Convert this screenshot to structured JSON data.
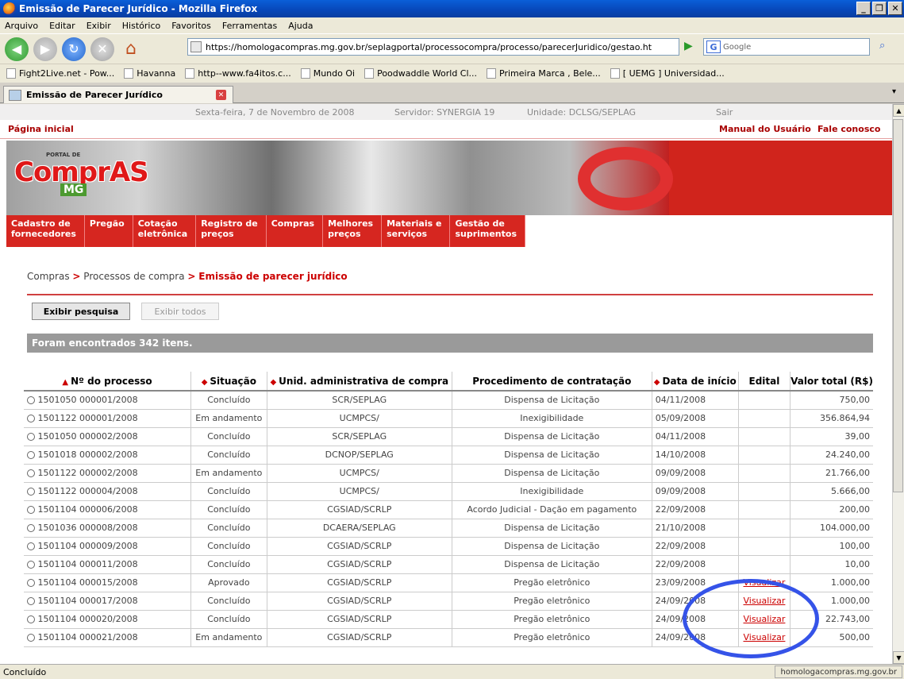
{
  "window": {
    "title": "Emissão de Parecer Jurídico - Mozilla Firefox"
  },
  "menubar": [
    "Arquivo",
    "Editar",
    "Exibir",
    "Histórico",
    "Favoritos",
    "Ferramentas",
    "Ajuda"
  ],
  "nav": {
    "url": "https://homologacompras.mg.gov.br/seplagportal/processocompra/processo/parecerJuridico/gestao.ht",
    "search_placeholder": "Google"
  },
  "bookmarks": [
    "Fight2Live.net - Pow...",
    "Havanna",
    "http--www.fa4itos.c...",
    "Mundo Oi",
    "Poodwaddle World Cl...",
    "Primeira Marca , Bele...",
    "[ UEMG ] Universidad..."
  ],
  "tab": {
    "label": "Emissão de Parecer Jurídico"
  },
  "info": {
    "date": "Sexta-feira, 7 de Novembro de 2008",
    "server": "Servidor: SYNERGIA 19",
    "unit": "Unidade: DCLSG/SEPLAG",
    "logout": "Sair"
  },
  "links": {
    "home": "Página inicial",
    "manual": "Manual do Usuário",
    "contact": "Fale conosco"
  },
  "logo": {
    "top": "PORTAL DE",
    "main": "ComprAS",
    "sub": "MG"
  },
  "menu": [
    [
      "Cadastro de",
      "fornecedores"
    ],
    [
      "Pregão",
      ""
    ],
    [
      "Cotação",
      "eletrônica"
    ],
    [
      "Registro de",
      "preços"
    ],
    [
      "Compras",
      ""
    ],
    [
      "Melhores",
      "preços"
    ],
    [
      "Materiais e",
      "serviços"
    ],
    [
      "Gestão de",
      "suprimentos"
    ]
  ],
  "breadcrumb": {
    "a": "Compras",
    "b": "Processos de compra",
    "current": "Emissão de parecer jurídico",
    "sep": ">"
  },
  "buttons": {
    "search": "Exibir pesquisa",
    "all": "Exibir todos"
  },
  "found": "Foram encontrados 342 itens.",
  "table": {
    "headers": [
      "Nº do processo",
      "Situação",
      "Unid. administrativa de compra",
      "Procedimento de contratação",
      "Data de início",
      "Edital",
      "Valor total (R$)"
    ],
    "rows": [
      [
        "1501050 000001/2008",
        "Concluído",
        "SCR/SEPLAG",
        "Dispensa de Licitação",
        "04/11/2008",
        "",
        "750,00"
      ],
      [
        "1501122 000001/2008",
        "Em andamento",
        "UCMPCS/",
        "Inexigibilidade",
        "05/09/2008",
        "",
        "356.864,94"
      ],
      [
        "1501050 000002/2008",
        "Concluído",
        "SCR/SEPLAG",
        "Dispensa de Licitação",
        "04/11/2008",
        "",
        "39,00"
      ],
      [
        "1501018 000002/2008",
        "Concluído",
        "DCNOP/SEPLAG",
        "Dispensa de Licitação",
        "14/10/2008",
        "",
        "24.240,00"
      ],
      [
        "1501122 000002/2008",
        "Em andamento",
        "UCMPCS/",
        "Dispensa de Licitação",
        "09/09/2008",
        "",
        "21.766,00"
      ],
      [
        "1501122 000004/2008",
        "Concluído",
        "UCMPCS/",
        "Inexigibilidade",
        "09/09/2008",
        "",
        "5.666,00"
      ],
      [
        "1501104 000006/2008",
        "Concluído",
        "CGSIAD/SCRLP",
        "Acordo Judicial - Dação em pagamento",
        "22/09/2008",
        "",
        "200,00"
      ],
      [
        "1501036 000008/2008",
        "Concluído",
        "DCAERA/SEPLAG",
        "Dispensa de Licitação",
        "21/10/2008",
        "",
        "104.000,00"
      ],
      [
        "1501104 000009/2008",
        "Concluído",
        "CGSIAD/SCRLP",
        "Dispensa de Licitação",
        "22/09/2008",
        "",
        "100,00"
      ],
      [
        "1501104 000011/2008",
        "Concluído",
        "CGSIAD/SCRLP",
        "Dispensa de Licitação",
        "22/09/2008",
        "",
        "10,00"
      ],
      [
        "1501104 000015/2008",
        "Aprovado",
        "CGSIAD/SCRLP",
        "Pregão eletrônico",
        "23/09/2008",
        "Visualizar",
        "1.000,00"
      ],
      [
        "1501104 000017/2008",
        "Concluído",
        "CGSIAD/SCRLP",
        "Pregão eletrônico",
        "24/09/2008",
        "Visualizar",
        "1.000,00"
      ],
      [
        "1501104 000020/2008",
        "Concluído",
        "CGSIAD/SCRLP",
        "Pregão eletrônico",
        "24/09/2008",
        "Visualizar",
        "22.743,00"
      ],
      [
        "1501104 000021/2008",
        "Em andamento",
        "CGSIAD/SCRLP",
        "Pregão eletrônico",
        "24/09/2008",
        "Visualizar",
        "500,00"
      ]
    ]
  },
  "status": {
    "left": "Concluído",
    "right": "homologacompras.mg.gov.br"
  }
}
